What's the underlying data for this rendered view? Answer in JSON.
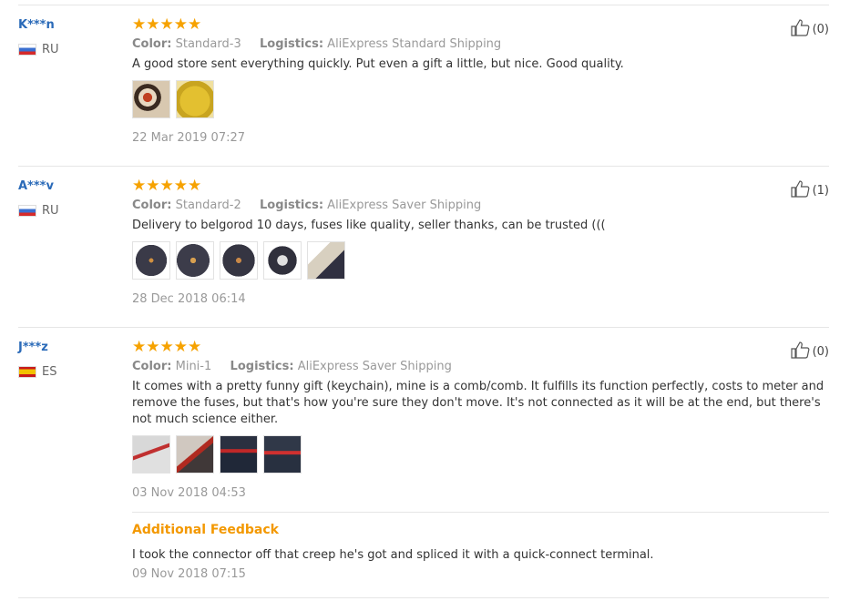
{
  "labels": {
    "color": "Color:",
    "logistics": "Logistics:"
  },
  "stars": "★★★★★",
  "reviews": [
    {
      "user": "K***n",
      "country": "RU",
      "color": "Standard-3",
      "logistics": "AliExpress Standard Shipping",
      "text": "A good store sent everything quickly. Put even a gift a little, but nice. Good quality.",
      "photo_count": 2,
      "date": "22 Mar 2019 07:27",
      "helpful": "(0)"
    },
    {
      "user": "A***v",
      "country": "RU",
      "color": "Standard-2",
      "logistics": "AliExpress Saver Shipping",
      "text": "Delivery to belgorod 10 days, fuses like quality, seller thanks, can be trusted (((",
      "photo_count": 5,
      "date": "28 Dec 2018 06:14",
      "helpful": "(1)"
    },
    {
      "user": "J***z",
      "country": "ES",
      "color": "Mini-1",
      "logistics": "AliExpress Saver Shipping",
      "text": "It comes with a pretty funny gift (keychain), mine is a comb/comb. It fulfills its function perfectly, costs to meter and remove the fuses, but that's how you're sure they don't move. It's not connected as it will be at the end, but there's not much science either.",
      "photo_count": 4,
      "date": "03 Nov 2018 04:53",
      "helpful": "(0)",
      "additional": {
        "title": "Additional Feedback",
        "text": "I took the connector off that creep he's got and spliced it with a quick-connect terminal.",
        "date": "09 Nov 2018 07:15"
      }
    }
  ],
  "icons": {
    "helpful": "thumbs-up-icon",
    "flag_ru": "russia-flag-icon",
    "flag_es": "spain-flag-icon"
  }
}
